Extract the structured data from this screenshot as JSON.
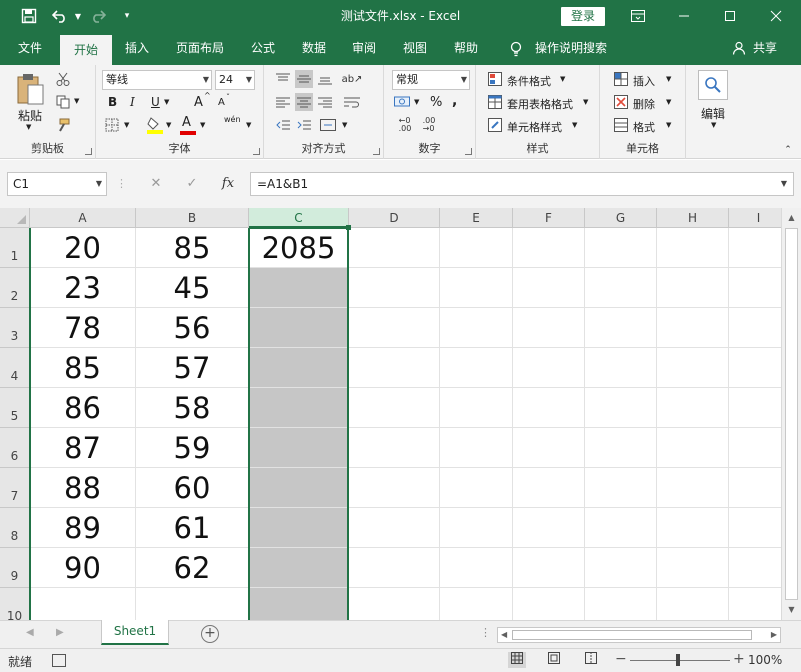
{
  "titlebar": {
    "save_icon": "save-icon",
    "undo_icon": "undo-icon",
    "redo_icon": "redo-icon",
    "customize_icon": "customize-quick-access-icon",
    "document_title": "测试文件.xlsx  -  Excel",
    "login_label": "登录",
    "ribbon_display_icon": "ribbon-display-options-icon",
    "minimize_icon": "minimize-icon",
    "maximize_icon": "maximize-icon",
    "close_icon": "close-icon"
  },
  "tabs": [
    {
      "label": "文件"
    },
    {
      "label": "开始"
    },
    {
      "label": "插入"
    },
    {
      "label": "页面布局"
    },
    {
      "label": "公式"
    },
    {
      "label": "数据"
    },
    {
      "label": "审阅"
    },
    {
      "label": "视图"
    },
    {
      "label": "帮助"
    }
  ],
  "tell_me": {
    "label": "操作说明搜索"
  },
  "share": {
    "label": "共享"
  },
  "ribbon": {
    "clipboard": {
      "paste_label": "粘贴",
      "group_label": "剪贴板"
    },
    "font": {
      "font_name": "等线",
      "font_size": "24",
      "bold": "B",
      "italic": "I",
      "underline": "U",
      "grow": "A",
      "shrink": "A",
      "font_color_letter": "A",
      "phonetic": "wén",
      "group_label": "字体"
    },
    "alignment": {
      "group_label": "对齐方式"
    },
    "number": {
      "format": "常规",
      "percent": "%",
      "comma": ",",
      "group_label": "数字"
    },
    "styles": {
      "conditional": "条件格式",
      "table": "套用表格格式",
      "cell": "单元格样式",
      "group_label": "样式"
    },
    "cells": {
      "insert": "插入",
      "delete": "删除",
      "format": "格式",
      "group_label": "单元格"
    },
    "editing": {
      "label": "编辑"
    }
  },
  "formula_bar": {
    "name_box": "C1",
    "cancel": "✕",
    "enter": "✓",
    "fx": "fx",
    "formula": "=A1&B1"
  },
  "sheet": {
    "columns": [
      "A",
      "B",
      "C",
      "D",
      "E",
      "F",
      "G",
      "H",
      "I"
    ],
    "rows": [
      "1",
      "2",
      "3",
      "4",
      "5",
      "6",
      "7",
      "8",
      "9",
      "10"
    ],
    "col_a": [
      "20",
      "23",
      "78",
      "85",
      "86",
      "87",
      "88",
      "89",
      "90"
    ],
    "col_b": [
      "85",
      "45",
      "56",
      "57",
      "58",
      "59",
      "60",
      "61",
      "62"
    ],
    "c1": "2085"
  },
  "sheet_tabs": {
    "active": "Sheet1",
    "add_icon": "add-sheet-icon"
  },
  "status": {
    "ready": "就绪",
    "zoom": "100%"
  }
}
